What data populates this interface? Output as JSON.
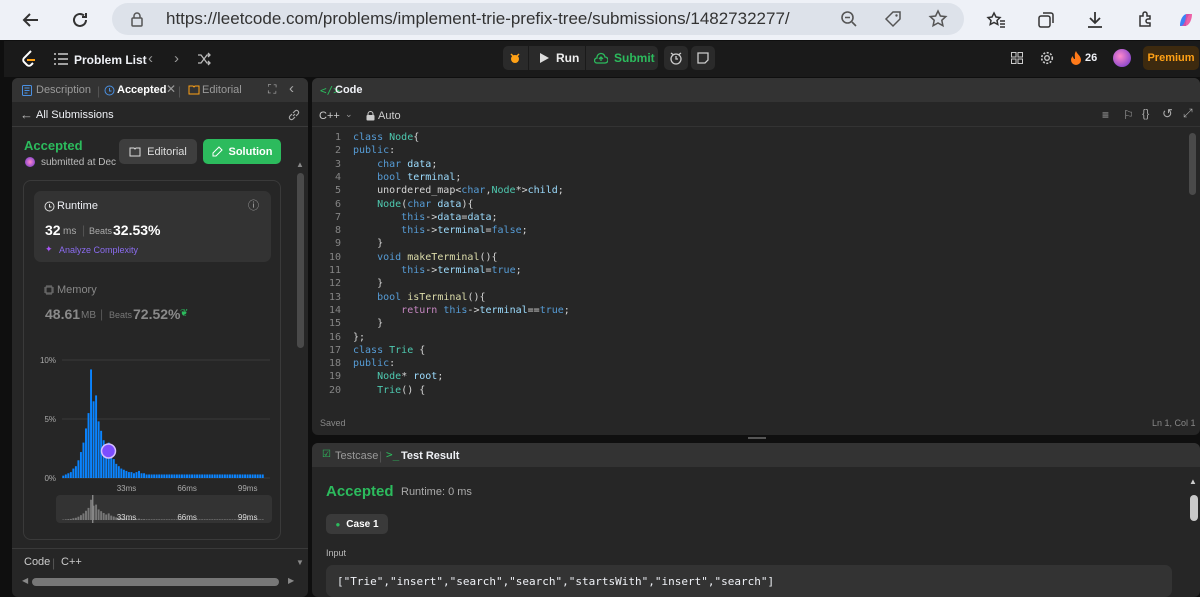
{
  "browser": {
    "url": "https://leetcode.com/problems/implement-trie-prefix-tree/submissions/1482732277/"
  },
  "topbar": {
    "problem_list": "Problem List",
    "run": "Run",
    "submit": "Submit",
    "streak": "26",
    "premium": "Premium"
  },
  "left": {
    "tabs": [
      "Description",
      "Accepted",
      "Editorial"
    ],
    "all_submissions": "All Submissions",
    "status": "Accepted",
    "submitted": "submitted at Dec",
    "editorial_btn": "Editorial",
    "solution_btn": "Solution",
    "runtime": {
      "label": "Runtime",
      "value": "32",
      "unit": "ms",
      "beats_label": "Beats",
      "beats": "32.53%",
      "analyze": "Analyze Complexity"
    },
    "memory": {
      "label": "Memory",
      "value": "48.61",
      "unit": "MB",
      "beats_label": "Beats",
      "beats": "72.52%"
    },
    "footer": {
      "code": "Code",
      "lang": "C++"
    }
  },
  "chart_data": {
    "type": "bar",
    "title": "",
    "xlabel": "",
    "ylabel": "",
    "ylim": [
      0,
      10
    ],
    "y_ticks": [
      "10%",
      "5%",
      "0%"
    ],
    "x_ticks": [
      "33ms",
      "66ms",
      "99ms"
    ],
    "mini_x_ticks": [
      "33ms",
      "66ms",
      "99ms"
    ],
    "values": [
      0.2,
      0.3,
      0.4,
      0.5,
      0.8,
      1.0,
      1.5,
      2.2,
      3.0,
      4.2,
      5.5,
      9.2,
      6.5,
      7.0,
      4.8,
      4.0,
      3.2,
      2.5,
      3.0,
      2.0,
      1.6,
      1.2,
      1.0,
      0.8,
      0.7,
      0.6,
      0.5,
      0.5,
      0.4,
      0.5,
      0.6,
      0.4,
      0.4,
      0.3,
      0.3,
      0.3,
      0.3,
      0.3,
      0.3,
      0.3,
      0.3,
      0.3,
      0.3,
      0.3,
      0.3,
      0.3,
      0.3,
      0.3,
      0.3,
      0.3,
      0.3,
      0.3,
      0.3,
      0.3,
      0.3,
      0.3,
      0.3,
      0.3,
      0.3,
      0.3,
      0.3,
      0.3,
      0.3,
      0.3,
      0.3,
      0.3,
      0.3,
      0.3,
      0.3,
      0.3,
      0.3,
      0.3,
      0.3,
      0.3,
      0.3,
      0.3,
      0.3,
      0.3,
      0.3,
      0.3
    ]
  },
  "editor": {
    "title": "Code",
    "lang": "C++",
    "auto": "Auto",
    "saved": "Saved",
    "position": "Ln 1, Col 1",
    "lines": [
      "class Node{",
      "public:",
      "    char data;",
      "    bool terminal;",
      "    unordered_map<char,Node*>child;",
      "    Node(char data){",
      "        this->data=data;",
      "        this->terminal=false;",
      "    }",
      "    void makeTerminal(){",
      "        this->terminal=true;",
      "    }",
      "    bool isTerminal(){",
      "        return this->terminal==true;",
      "    }",
      "};",
      "class Trie {",
      "public:",
      "    Node* root;",
      "    Trie() {"
    ]
  },
  "result": {
    "tab_testcase": "Testcase",
    "tab_result": "Test Result",
    "status": "Accepted",
    "runtime": "Runtime: 0 ms",
    "case": "Case 1",
    "input_label": "Input",
    "input_value": "[\"Trie\",\"insert\",\"search\",\"search\",\"startsWith\",\"insert\",\"search\"]"
  },
  "colors": {
    "accent_green": "#2cbb5d",
    "bar_blue": "#0a84ff",
    "premium": "#ffa116"
  }
}
